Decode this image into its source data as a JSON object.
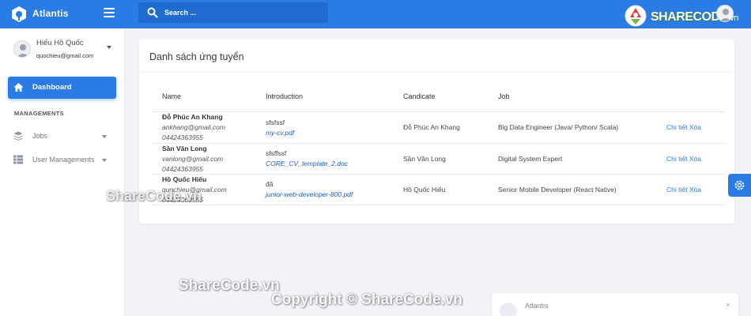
{
  "app": {
    "brand": "Atlantis",
    "search_placeholder": "Search ...",
    "watermark_logo": {
      "text": "SHARECODE",
      "suffix": ".vn"
    }
  },
  "sidebar": {
    "user_name": "Hiếu Hồ Quốc",
    "user_email": "quochieu@gmail.com",
    "active_item": "Dashboard",
    "section_title": "MANAGEMENTS",
    "items": [
      {
        "label": "Jobs",
        "icon": "layers-icon"
      },
      {
        "label": "User Managements",
        "icon": "table-icon"
      }
    ]
  },
  "card": {
    "title": "Danh sách ứng tuyển",
    "columns": [
      "Name",
      "Introduction",
      "Candicate",
      "Job"
    ],
    "rows": [
      {
        "name": "Đỗ Phúc An Khang",
        "email": "ankhang@gmail.com",
        "phone": "04424363955",
        "intro": "sfsfssf",
        "file": "my-cv.pdf",
        "candidate": "Đỗ Phúc An Khang",
        "job": "Big Data Engineer (Java/ Python/ Scala)",
        "actions": "Chi tiết Xóa"
      },
      {
        "name": "Sần Văn Long",
        "email": "vanlong@gmail.com",
        "phone": "04424363955",
        "intro": "sfsffssf",
        "file": "CORE_CV_template_2.doc",
        "candidate": "Sần Văn Long",
        "job": "Digital System Expert",
        "actions": "Chi tiết Xóa"
      },
      {
        "name": "Hồ Quốc Hiếu",
        "email": "quochieu@gmail.com",
        "phone": "04424363955",
        "intro": "đã",
        "file": "junior-web-developer-800.pdf",
        "candidate": "Hồ Quốc Hiếu",
        "job": "Senior Mobile Developer (React Native)",
        "actions": "Chi tiết Xóa"
      }
    ]
  },
  "popup": {
    "title": "Atlantis",
    "close": "×"
  },
  "watermarks": [
    "ShareCode.vn",
    "ShareCode.vn",
    "Copyright © ShareCode.vn"
  ],
  "colors": {
    "primary": "#2a7ce4",
    "background": "#f2f3f8",
    "link": "#1c5fb8"
  }
}
